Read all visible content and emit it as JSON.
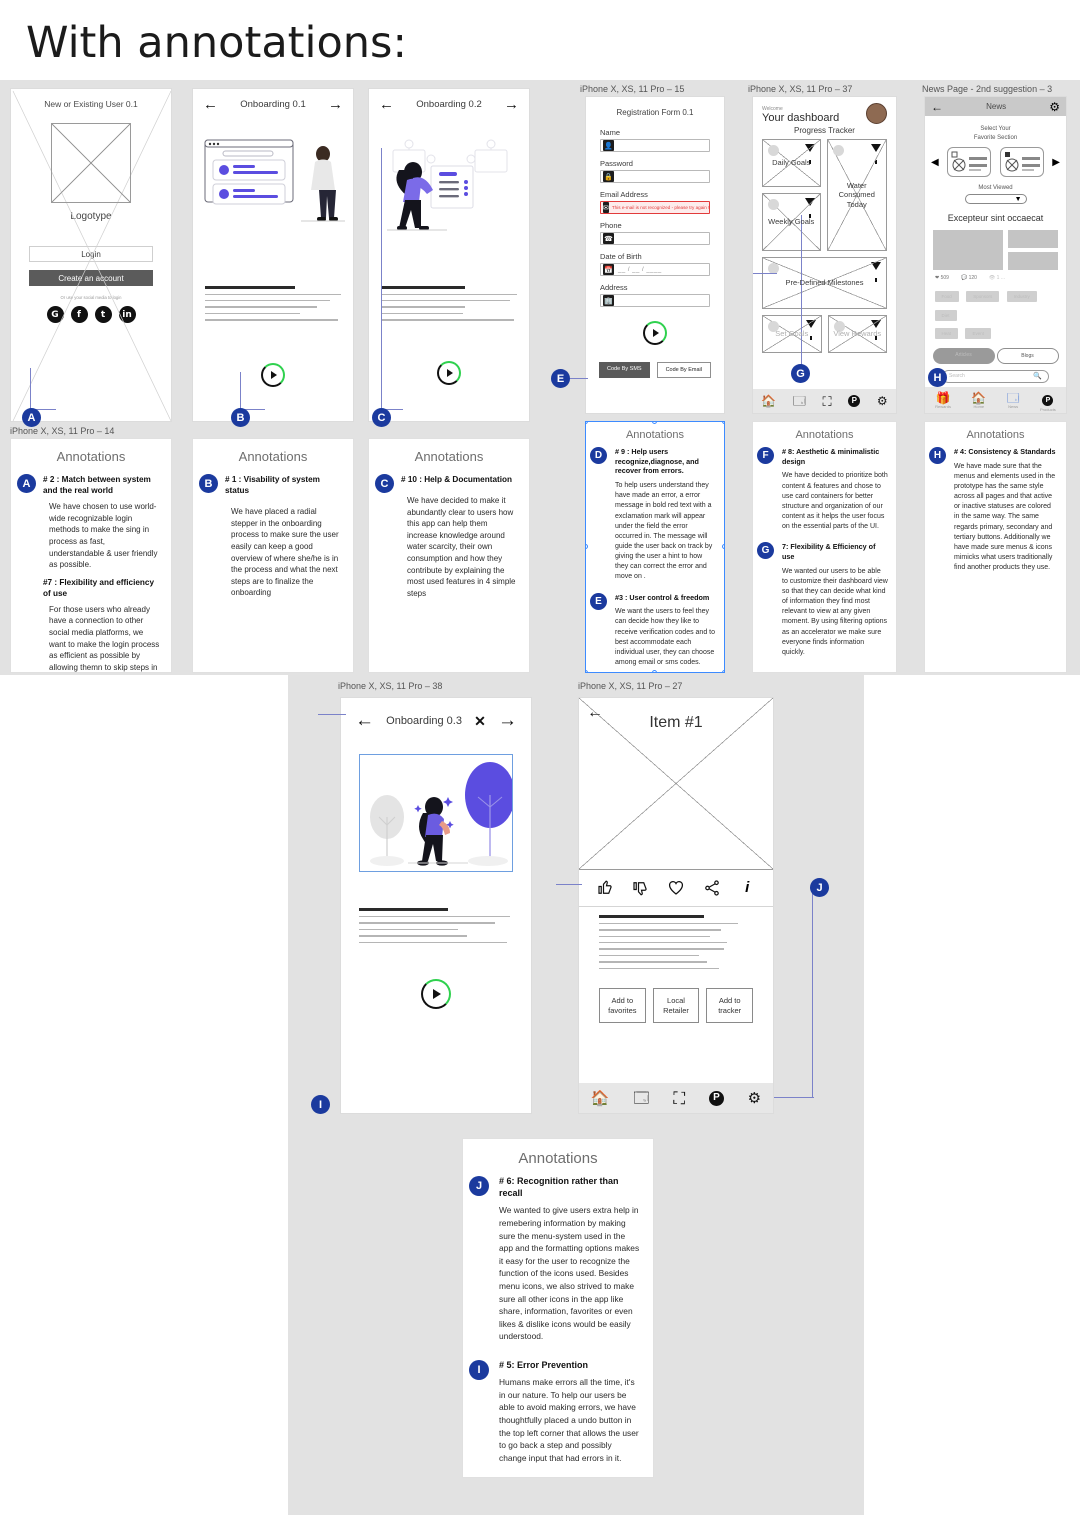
{
  "page": {
    "title": "With annotations:"
  },
  "frames": {
    "login": {
      "label": "iPhone X, XS, 11 Pro – 14"
    },
    "reg": {
      "label": "iPhone X, XS, 11 Pro – 15"
    },
    "dash": {
      "label": "iPhone X, XS, 11 Pro – 37"
    },
    "news": {
      "label": "News Page - 2nd suggestion – 3"
    },
    "onb3": {
      "label": "iPhone X, XS, 11 Pro – 38"
    },
    "item": {
      "label": "iPhone X, XS, 11 Pro – 27"
    }
  },
  "login_screen": {
    "title": "New or Existing User 0.1",
    "logo_label": "Logotype",
    "login_button": "Login",
    "create_button": "Create an account",
    "social_hint": "Or use your social media to login",
    "socials": [
      "G",
      "f",
      "t",
      "in"
    ]
  },
  "onboarding1": {
    "title": "Onboarding 0.1",
    "back": "←",
    "next": "→"
  },
  "onboarding2": {
    "title": "Onboarding 0.2",
    "back": "←",
    "next": "→"
  },
  "onboarding3": {
    "title": "Onboarding 0.3",
    "back": "←",
    "close": "✕",
    "next": "→"
  },
  "registration": {
    "title": "Registration Form 0.1",
    "fields": [
      {
        "label": "Name",
        "icon": "person-icon",
        "value": ""
      },
      {
        "label": "Password",
        "icon": "lock-icon",
        "value": ""
      },
      {
        "label": "Email Address",
        "icon": "mail-icon",
        "value": "",
        "error": "This e-mail is not recognized - please try again !"
      },
      {
        "label": "Phone",
        "icon": "phone-icon",
        "value": ""
      },
      {
        "label": "Date of Birth",
        "icon": "calendar-icon",
        "value": "__ / __ / ____"
      },
      {
        "label": "Address",
        "icon": "building-icon",
        "value": ""
      }
    ],
    "buttons": {
      "sms": "Code By SMS",
      "email": "Code By Email"
    }
  },
  "dashboard": {
    "welcome": "Welcome",
    "title": "Your dashboard",
    "subtitle": "Progress Tracker",
    "cards": [
      "Daily Goals",
      "Water Consumed Today",
      "Weekly Goals",
      "Pre-Defined Milestones",
      "Set Goals",
      "View Rewards"
    ],
    "nav": [
      "home-icon",
      "news-icon",
      "scan-icon",
      "products-icon",
      "settings-icon"
    ]
  },
  "news": {
    "title": "News",
    "select_section": "Select Your\nFavorite Section",
    "most_viewed": "Most Viewed",
    "headline": "Excepteur sint occaecat",
    "stats": {
      "likes": "509",
      "comments": "120",
      "views": "1 ..."
    },
    "tags": [
      "Food",
      "Sponsors",
      "Industry",
      "Diet",
      "Heat",
      "Event"
    ],
    "toggle": {
      "active": "Articles",
      "inactive": "Blogs"
    },
    "search_placeholder": "Search",
    "nav": [
      {
        "icon": "rewards-icon",
        "label": "Rewards"
      },
      {
        "icon": "home-icon",
        "label": "Home"
      },
      {
        "icon": "news-icon",
        "label": "News"
      },
      {
        "icon": "products-icon",
        "label": "Products"
      }
    ]
  },
  "item": {
    "title": "Item #1",
    "back": "←",
    "icons": [
      "thumbs-up-icon",
      "thumbs-down-icon",
      "heart-icon",
      "share-icon",
      "info-icon"
    ],
    "buttons": [
      "Add to favorites",
      "Local Retailer",
      "Add to tracker"
    ],
    "nav": [
      "home-icon",
      "news-icon",
      "scan-icon",
      "products-icon",
      "settings-icon"
    ]
  },
  "annotations": {
    "heading": "Annotations",
    "a": {
      "badge": "A",
      "h1": "# 2 : Match between system and the real world",
      "p1": "We have chosen to use world-wide recognizable login methods to make the sing in process as fast, understandable & user friendly as possible.",
      "h2": "#7 : Flexibility and efficiency of use",
      "p2": "For those users who already have a connection to other social media platforms, we want to make the login process as efficient as possible by allowing themn to skip steps in creating a profile as we can use the data from connected platforms instead."
    },
    "b": {
      "badge": "B",
      "h1": "# 1 : Visability of system status",
      "p1": "We have placed a radial stepper in the onboarding process to make sure the user easily can keep a good overview of where she/he is in the process and what the next steps are to finalize the onboarding"
    },
    "c": {
      "badge": "C",
      "h1": "# 10 : Help & Documentation",
      "p1": "We have decided to make it abundantly clear to users how this app can help them increase knowledge around water scarcity, their own consumption and how they contribute by explaining the most used features in 4 simple steps"
    },
    "d": {
      "badge": "D",
      "h1": "# 9 : Help users recognize,diagnose, and recover from errors.",
      "p1": "To help users understand they have made an error, a error message in bold red text with a exclamation mark will appear under the field the error occurred in. The message will guide the user back on track by giving the user a hint to how they can correct the error and move on ."
    },
    "e": {
      "badge": "E",
      "h1": "#3 : User control & freedom",
      "p1": "We want the users to feel they can decide how they like to receive verification codes and to best accommodate each individual user, they can choose among email or sms codes."
    },
    "f": {
      "badge": "F",
      "h1": "# 8: Aesthetic & minimalistic design",
      "p1": "We have decided to prioritize both content & features and chose to use card containers for better structure and organization of our content as it helps the user focus on the essential parts of the UI."
    },
    "g": {
      "badge": "G",
      "h1": "7: Flexibility & Efficiency of use",
      "p1": "We wanted our users to be able to customize their dashboard view so that they can decide what kind of information they find most relevant to view at any given moment. By using filtering options as an accelerator we make sure everyone finds information quickly."
    },
    "h": {
      "badge": "H",
      "h1": "# 4: Consistency & Standards",
      "p1": "We have made sure that the menus and elements used in the prototype has the same style across all pages and that active or inactive statuses are colored in the same way. The same regards primary, secondary and tertiary buttons. Additionally we have made sure menus & icons mimicks what users traditionally find another products they use."
    },
    "j": {
      "badge": "J",
      "h1": "# 6: Recognition rather than recall",
      "p1": "We  wanted to give users extra help in remebering information by making sure the menu-system used in the app  and the formatting options makes it easy for the user to recognize the function of the icons used. Besides menu icons, we also strived to make sure all other icons in the app like share, information, favorites or even likes & dislike icons would be easily understood."
    },
    "i": {
      "badge": "I",
      "h1": "# 5: Error Prevention",
      "p1": "Humans make errors all the time, it's in our nature. To help our users be able to avoid making errors, we have thoughtfully placed a undo button in the top left corner that allows the user to go back a step and possibly change input that had errors in it."
    }
  },
  "colors": {
    "accent_blue": "#1b3a9e",
    "purple": "#5b4de0",
    "green": "#2fd14e",
    "error_red": "#e23b3b",
    "canvas": "#e2e2e2"
  }
}
